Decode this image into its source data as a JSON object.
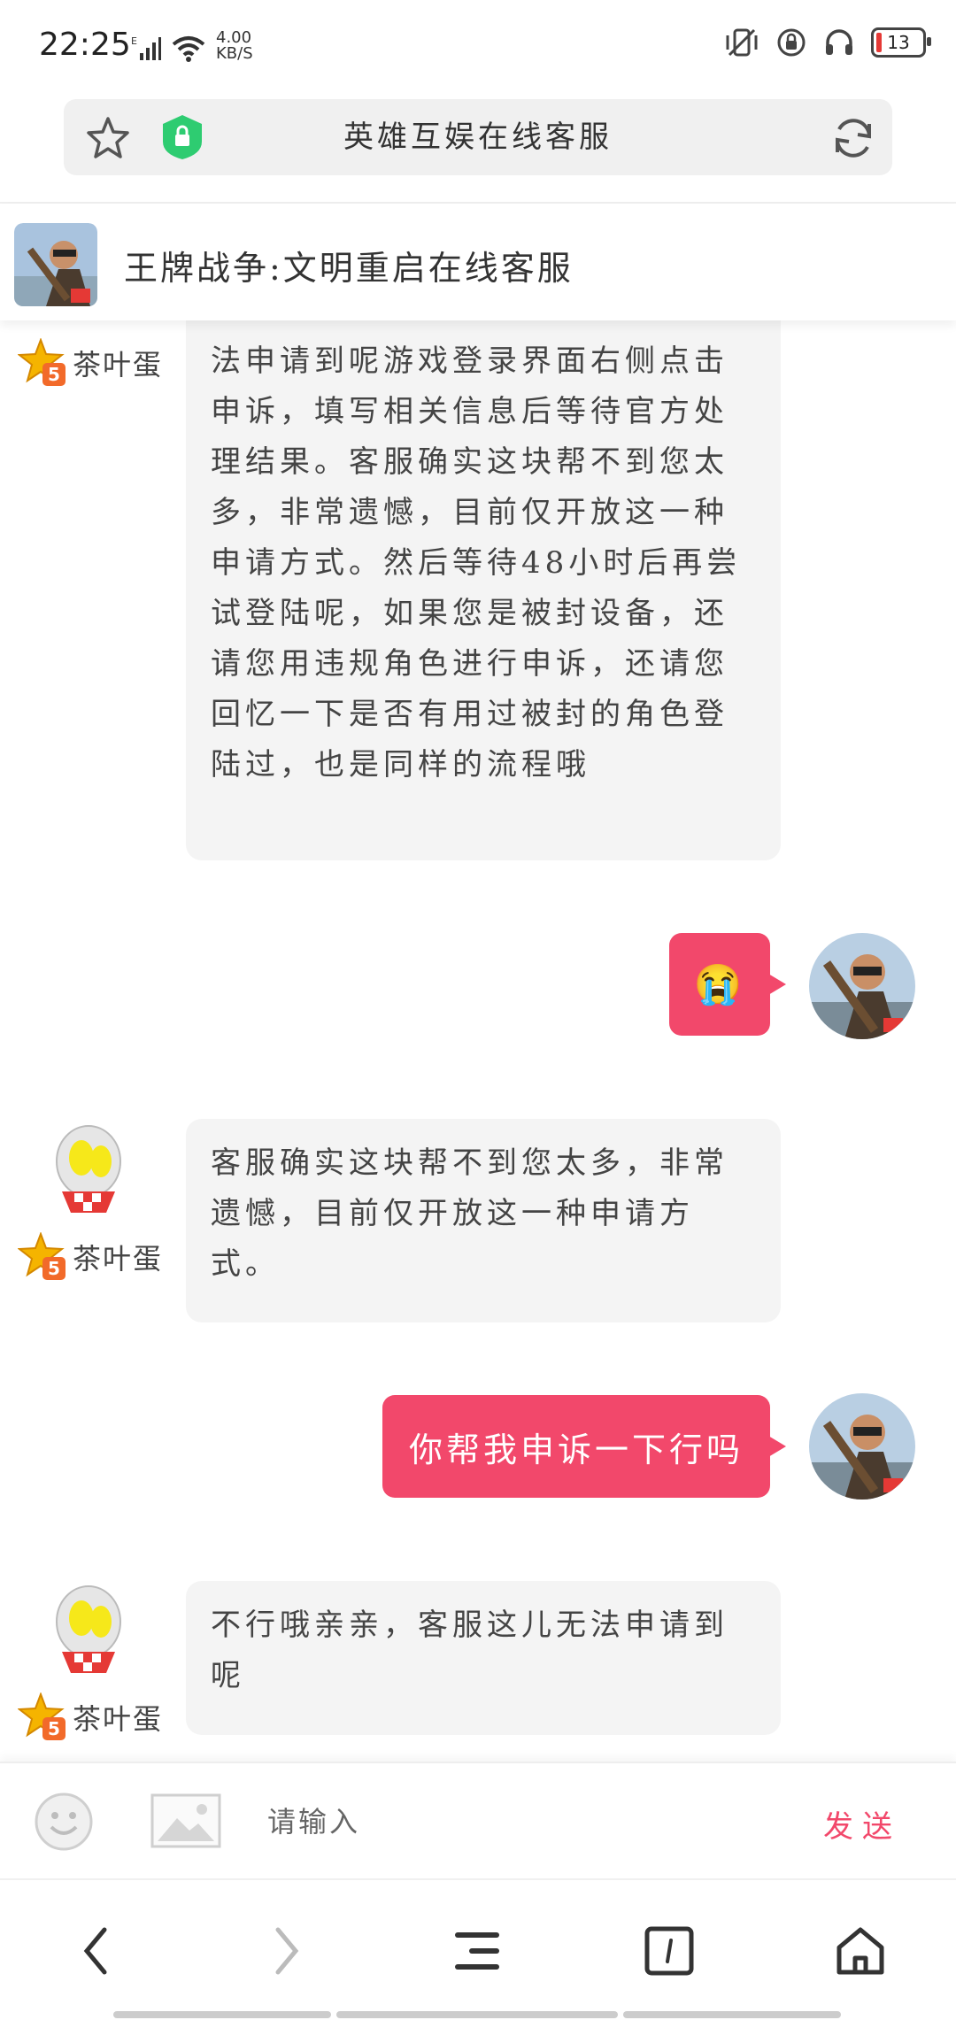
{
  "status": {
    "time": "22:25",
    "network_speed_value": "4.00",
    "network_speed_unit": "KB/S",
    "battery": "13"
  },
  "browser": {
    "page_title": "英雄互娱在线客服"
  },
  "chat": {
    "title": "王牌战争:文明重启在线客服",
    "agent_name": "茶叶蛋",
    "messages": [
      {
        "from": "agent",
        "text": "法申请到呢游戏登录界面右侧点击申诉，填写相关信息后等待官方处理结果。客服确实这块帮不到您太多，非常遗憾，目前仅开放这一种申请方式。然后等待48小时后再尝试登陆呢，如果您是被封设备，还请您用违规角色进行申诉，还请您回忆一下是否有用过被封的角色登陆过，也是同样的流程哦"
      },
      {
        "from": "user",
        "text": "😭"
      },
      {
        "from": "agent",
        "text": "客服确实这块帮不到您太多，非常遗憾，目前仅开放这一种申请方式。"
      },
      {
        "from": "user",
        "text": "你帮我申诉一下行吗"
      },
      {
        "from": "agent",
        "text": "不行哦亲亲，客服这儿无法申请到呢"
      }
    ]
  },
  "input": {
    "placeholder": "请输入",
    "send_label": "发送"
  },
  "colors": {
    "accent": "#f2486b",
    "bubble_agent": "#f4f4f4",
    "shield": "#2ecc71"
  }
}
